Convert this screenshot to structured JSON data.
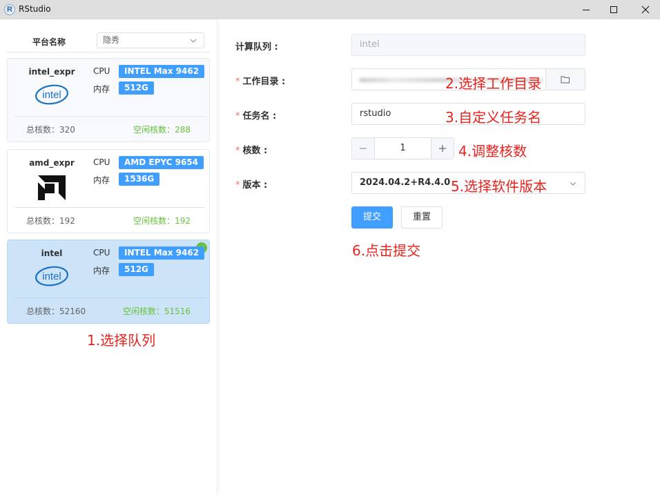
{
  "window": {
    "title": "RStudio",
    "icon": "r-logo-icon"
  },
  "sidebar": {
    "platform_label": "平台名称",
    "platform_value": "隐秀",
    "cpu_label": "CPU",
    "mem_label": "内存",
    "cards": [
      {
        "name": "intel_expr",
        "logo": "intel-logo",
        "cpu": "INTEL Max 9462",
        "mem": "512G",
        "total": "总核数：320",
        "idle": "空闲核数：288"
      },
      {
        "name": "amd_expr",
        "logo": "amd-logo",
        "cpu": "AMD EPYC 9654",
        "mem": "1536G",
        "total": "总核数：192",
        "idle": "空闲核数：192"
      },
      {
        "name": "intel",
        "logo": "intel-logo",
        "cpu": "INTEL Max 9462",
        "mem": "512G",
        "total": "总核数：52160",
        "idle": "空闲核数：51516"
      }
    ]
  },
  "form": {
    "queue_label": "计算队列 :",
    "queue_value": "intel",
    "workdir_label": "工作目录 :",
    "jobname_label": "任务名 :",
    "jobname_value": "rstudio",
    "cores_label": "核数 :",
    "cores_value": "1",
    "version_label": "版本 :",
    "version_value": "2024.04.2+R4.4.0",
    "required_mark": "*",
    "submit_label": "提交",
    "reset_label": "重置"
  },
  "annotations": {
    "select_queue": "1.选择队列",
    "select_dir": "2.选择工作目录",
    "custom_name": "3.自定义任务名",
    "adjust_cores": "4.调整核数",
    "select_version": "5.选择软件版本",
    "click_submit": "6.点击提交"
  },
  "colors": {
    "primary": "#409eff",
    "success": "#67c23a",
    "annotation": "#e8231e",
    "selected_card": "#cde3f8"
  }
}
